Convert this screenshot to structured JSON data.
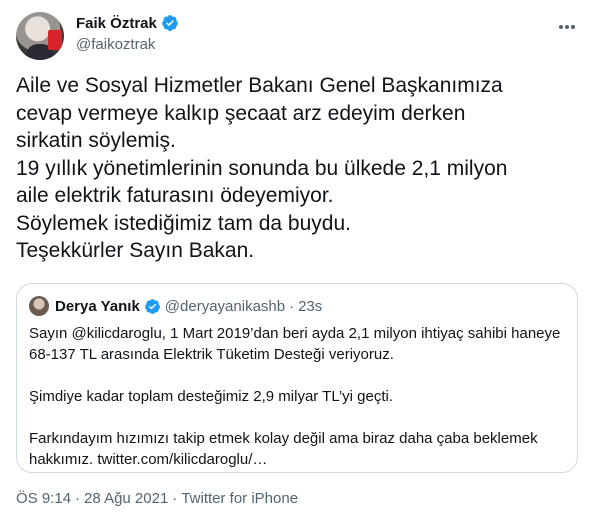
{
  "author": {
    "display_name": "Faik Öztrak",
    "handle": "@faikoztrak"
  },
  "tweet": {
    "lines": [
      "Aile ve Sosyal Hizmetler Bakanı Genel Başkanımıza",
      "cevap vermeye kalkıp şecaat arz edeyim derken",
      "sirkatin söylemiş.",
      "19 yıllık yönetimlerinin sonunda bu ülkede 2,1 milyon",
      "aile elektrik faturasını ödeyemiyor.",
      "Söylemek istediğimiz tam da buydu.",
      "Teşekkürler Sayın Bakan."
    ]
  },
  "quote": {
    "display_name": "Derya Yanık",
    "handle": "@deryayanikashb",
    "dot": "·",
    "time": "23s",
    "paragraphs": [
      [
        "Sayın @kilicdaroglu, 1 Mart 2019’dan beri ayda 2,1 milyon ihtiyaç sahibi haneye",
        "68-137 TL arasında Elektrik Tüketim Desteği veriyoruz."
      ],
      [
        "Şimdiye kadar toplam desteğimiz 2,9 milyar TL’yi geçti."
      ],
      [
        "Farkındayım hızımızı takip etmek kolay değil ama biraz daha çaba beklemek",
        "hakkımız. twitter.com/kilicdaroglu/…"
      ]
    ]
  },
  "meta": {
    "time": "ÖS 9:14",
    "date": "28 Ağu 2021",
    "source": "Twitter for iPhone",
    "separator": "·"
  },
  "colors": {
    "verified": "#1d9bf0",
    "secondary_text": "#536471",
    "border": "#cfd9de"
  },
  "icons": [
    "verified-badge-icon",
    "more-options-icon"
  ]
}
